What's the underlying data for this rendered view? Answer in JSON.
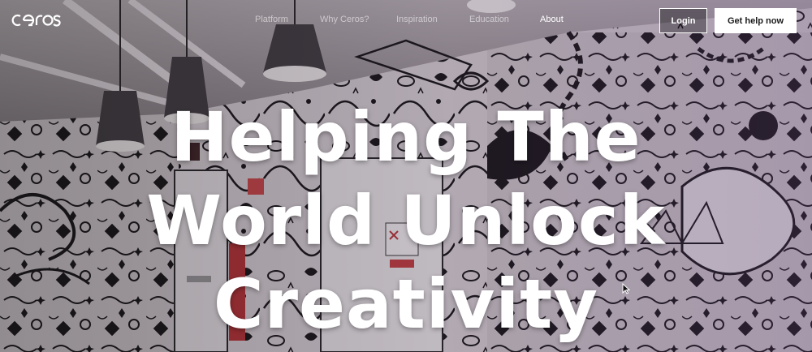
{
  "brand": {
    "logo_text": "ceros"
  },
  "nav": {
    "items": [
      {
        "label": "Platform"
      },
      {
        "label": "Why Ceros?"
      },
      {
        "label": "Inspiration"
      },
      {
        "label": "Education"
      },
      {
        "label": "About"
      }
    ],
    "active": "About"
  },
  "actions": {
    "login_label": "Login",
    "cta_label": "Get help now"
  },
  "hero": {
    "headline_lines": [
      "Helping The",
      "World Unlock",
      "Creativity"
    ]
  },
  "colors": {
    "text_primary": "#ffffff",
    "cta_background": "#ffffff",
    "cta_text": "#1a1a1a",
    "nav_muted": "rgba(255,255,255,0.55)",
    "overlay_tint": "#5a3c6e"
  },
  "icons": {
    "logo": "ceros-logo",
    "cursor": "mouse-pointer-icon"
  }
}
